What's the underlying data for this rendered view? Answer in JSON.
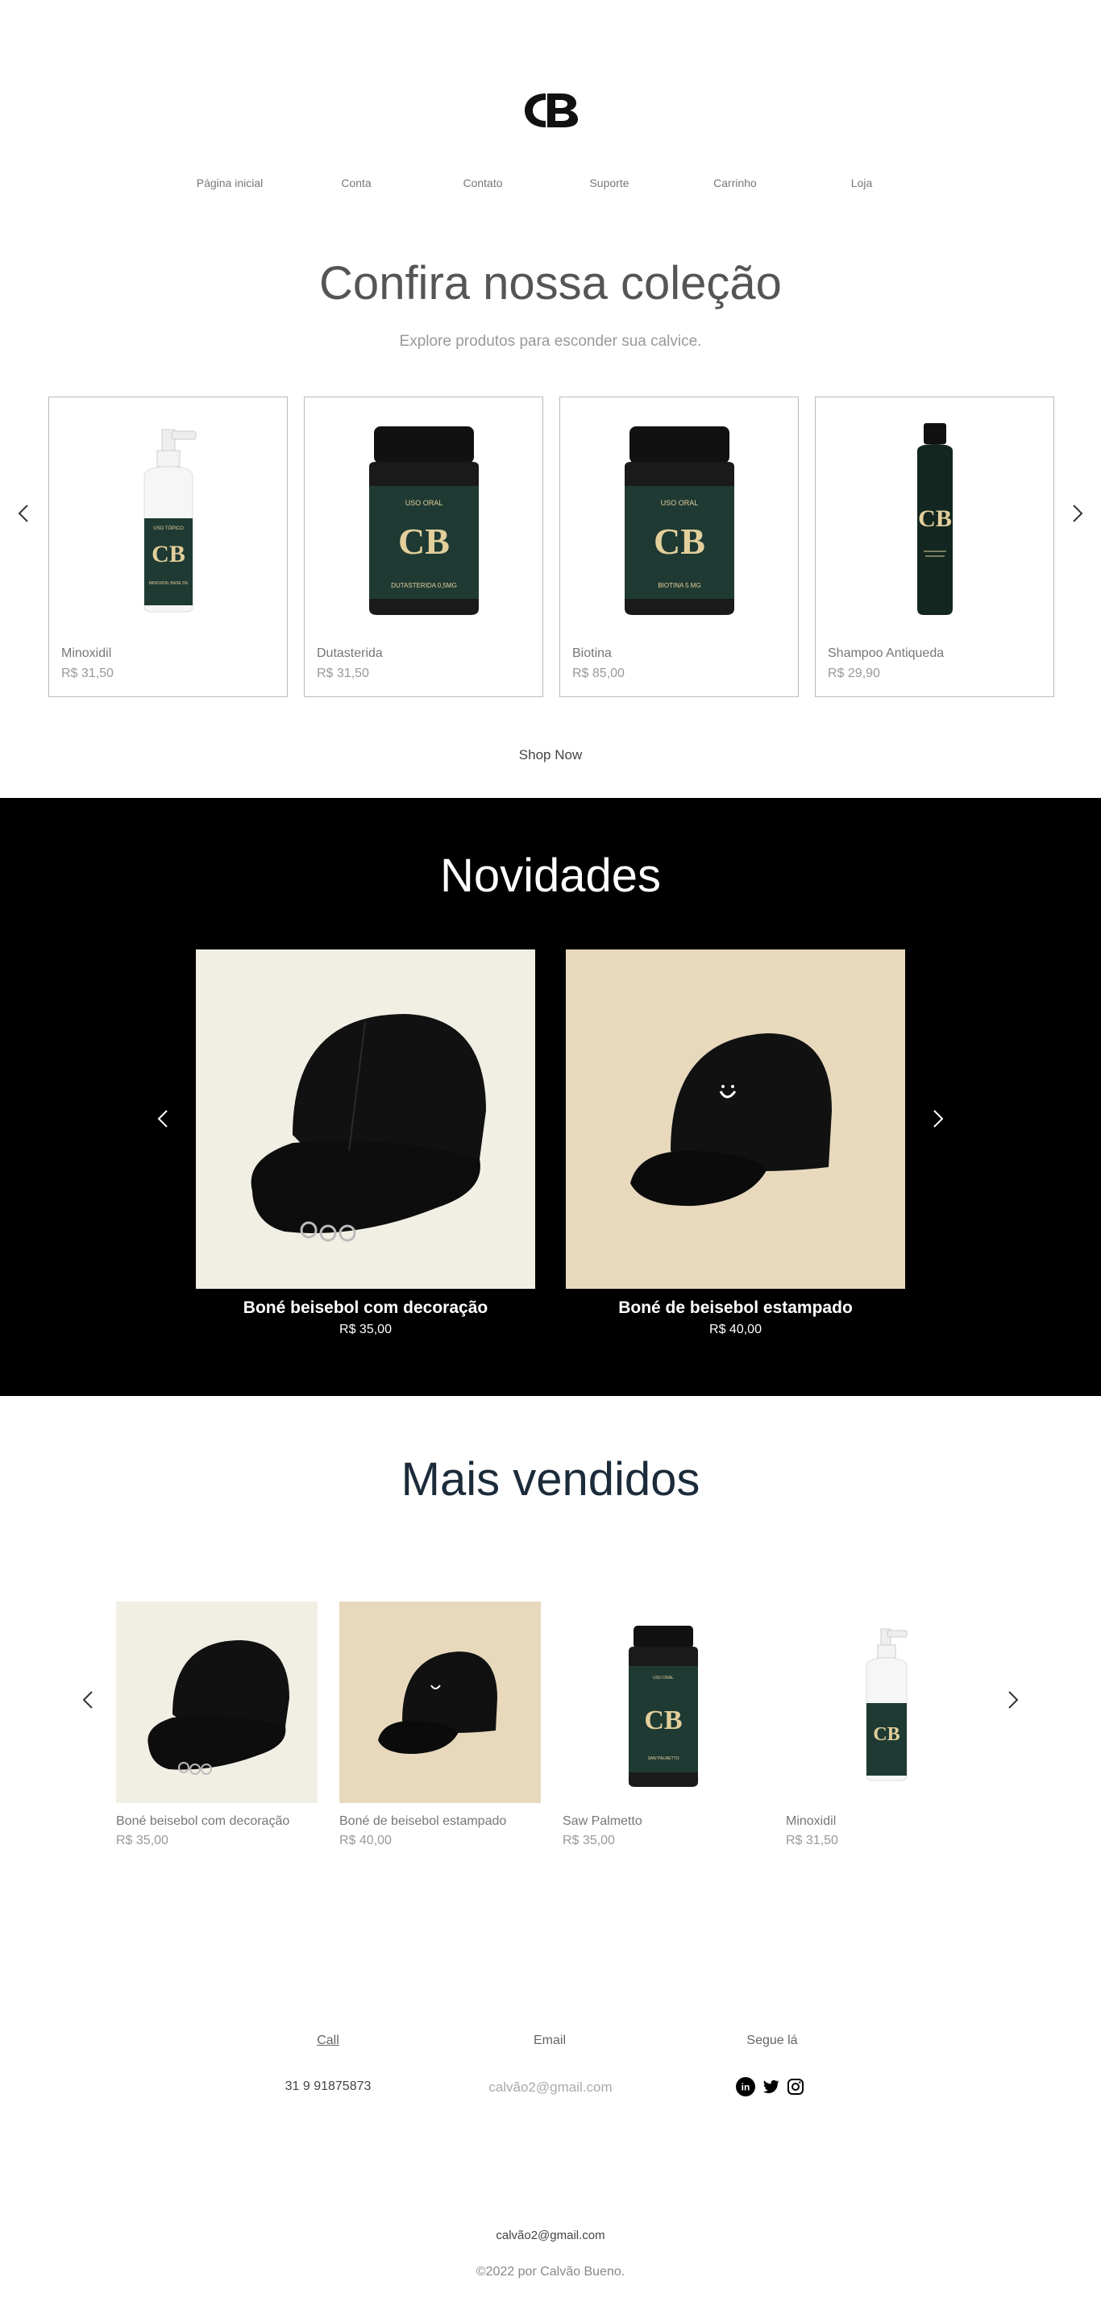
{
  "brand": {
    "logo_text": "CB"
  },
  "nav": {
    "items": [
      "Página inicial",
      "Conta",
      "Contato",
      "Suporte",
      "Carrinho",
      "Loja"
    ]
  },
  "collection": {
    "title": "Confira nossa coleção",
    "subtitle": "Explore produtos para esconder sua calvice.",
    "products": [
      {
        "name": "Minoxidil",
        "price": "R$ 31,50",
        "label_top": "USO TÓPICO",
        "label_bottom": "MINOXIDIL BASE 5%"
      },
      {
        "name": "Dutasterida",
        "price": "R$ 31,50",
        "label_top": "USO ORAL",
        "label_bottom": "DUTASTERIDA 0,5MG"
      },
      {
        "name": "Biotina",
        "price": "R$ 85,00",
        "label_top": "USO ORAL",
        "label_bottom": "BIOTINA 5 MG"
      },
      {
        "name": "Shampoo Antiqueda",
        "price": "R$ 29,90",
        "label_top": "",
        "label_bottom": ""
      }
    ],
    "shop_now": "Shop Now"
  },
  "novidades": {
    "title": "Novidades",
    "items": [
      {
        "name": "Boné beisebol com decoração",
        "price": "R$ 35,00"
      },
      {
        "name": "Boné de beisebol estampado",
        "price": "R$ 40,00"
      }
    ]
  },
  "mais_vendidos": {
    "title": "Mais vendidos",
    "items": [
      {
        "name": "Boné beisebol com decoração",
        "price": "R$ 35,00"
      },
      {
        "name": "Boné de beisebol estampado",
        "price": "R$ 40,00"
      },
      {
        "name": "Saw Palmetto",
        "price": "R$ 35,00"
      },
      {
        "name": "Minoxidil",
        "price": "R$ 31,50"
      }
    ]
  },
  "footer": {
    "call_label": "Call",
    "email_label": "Email",
    "social_label": "Segue lá",
    "phone": "31 9 91875873",
    "email": "calvão2@gmail.com",
    "email_bottom": "calvão2@gmail.com",
    "copyright": "©2022 por Calvão Bueno.",
    "social_icons": [
      "linkedin-icon",
      "twitter-icon",
      "instagram-icon"
    ]
  },
  "colors": {
    "bottle_green": "#1f3a33",
    "label_gold": "#e3cf9b",
    "cap_bg_light": "#f1efe4",
    "cap_bg_tan": "#e8d9bd",
    "novidades_bg": "#000000"
  }
}
